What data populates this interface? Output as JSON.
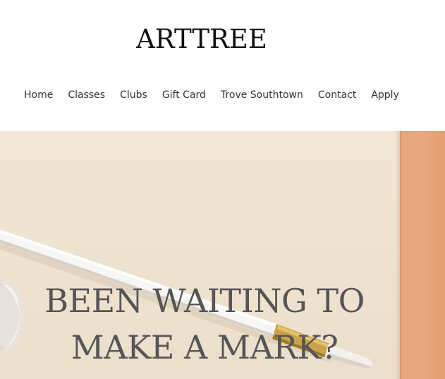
{
  "header": {
    "logo": "ARTTREE"
  },
  "nav": {
    "items": [
      {
        "label": "Home"
      },
      {
        "label": "Classes"
      },
      {
        "label": "Clubs"
      },
      {
        "label": "Gift Card"
      },
      {
        "label": "Trove Southtown"
      },
      {
        "label": "Contact"
      },
      {
        "label": "Apply"
      }
    ]
  },
  "hero": {
    "title_line1": "BEEN WAITING TO",
    "title_line2": "MAKE A MARK?",
    "icons": [
      "paintbrush-image",
      "paint-roll-image"
    ]
  },
  "colors": {
    "background": "#ffffff",
    "text_dark": "#111111",
    "nav_text": "#333333",
    "hero_text": "#555555",
    "paper": "#efe3d3",
    "accent_orange": "#e7a579",
    "brush_ferrule": "#c9a24a"
  }
}
